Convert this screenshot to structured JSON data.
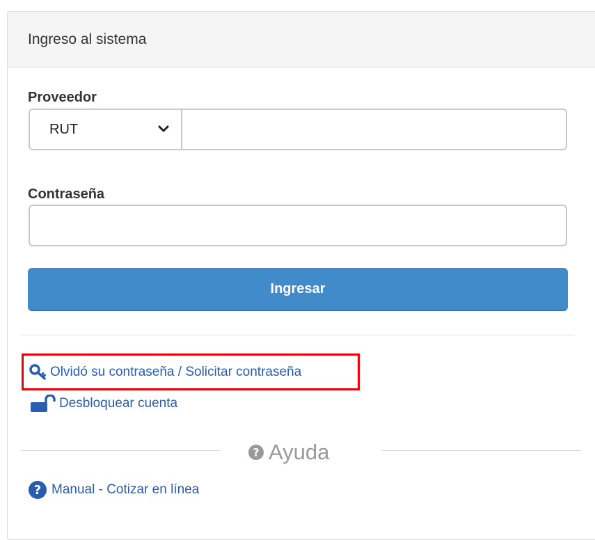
{
  "panel": {
    "title": "Ingreso al sistema"
  },
  "form": {
    "provider_label": "Proveedor",
    "id_type": {
      "selected": "RUT"
    },
    "rut_value": "",
    "password_label": "Contraseña",
    "password_value": "",
    "submit_label": "Ingresar"
  },
  "links": {
    "forgot_password": "Olvidó su contraseña / Solicitar contraseña",
    "unlock_account": "Desbloquear cuenta"
  },
  "help": {
    "heading": "Ayuda",
    "manual_link": "Manual - Cotizar en línea"
  },
  "icons": {
    "forgot": "key-icon",
    "unlock": "unlock-icon",
    "help_heading": "question-circle-icon",
    "manual": "question-circle-icon"
  },
  "colors": {
    "primary_button": "#428bca",
    "link": "#2a5db0",
    "highlight_box": "#e8000b"
  }
}
